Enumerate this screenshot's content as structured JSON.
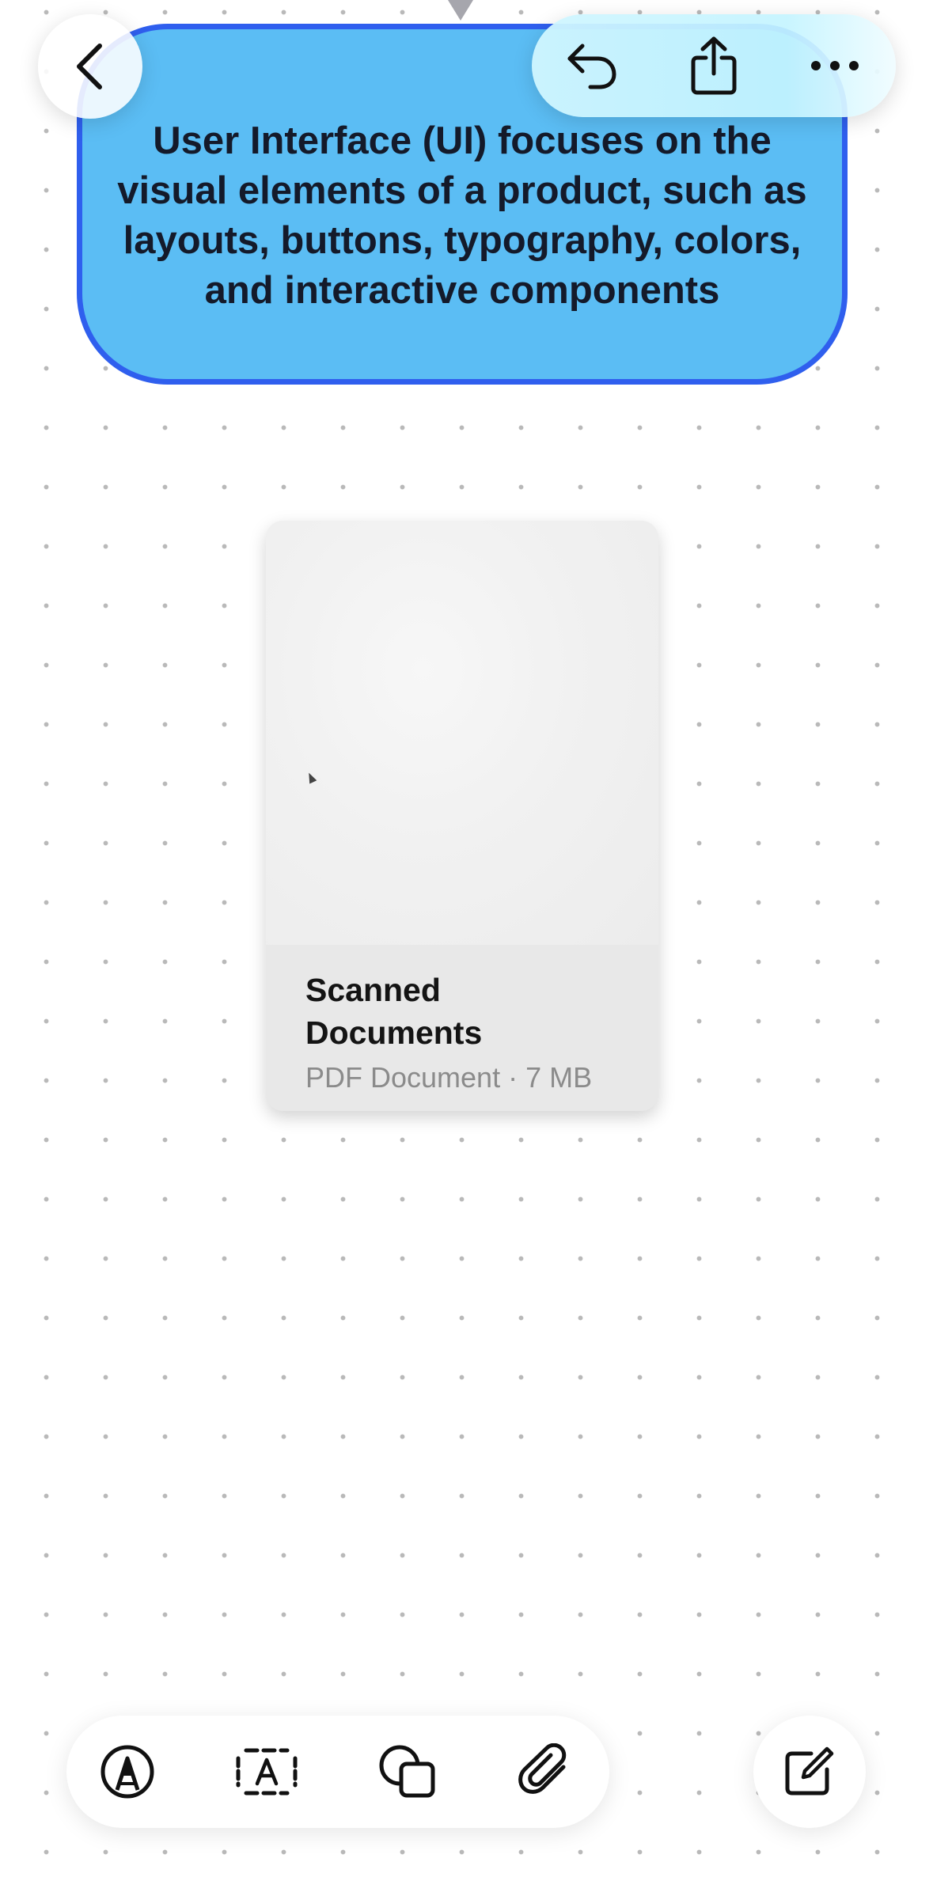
{
  "bubble": {
    "text": "User Interface (UI) focuses on the visual elements of a product, such as layouts, buttons, typography, colors, and interactive components"
  },
  "top_bar": {
    "back_icon": "chevron-left-icon",
    "undo_icon": "undo-icon",
    "share_icon": "share-icon",
    "more_icon": "ellipsis-icon"
  },
  "attachment": {
    "title": "Scanned Documents",
    "meta": "PDF Document · 7 MB"
  },
  "toolbar": {
    "pen_icon": "pen-icon",
    "text_icon": "text-box-icon",
    "shapes_icon": "shapes-icon",
    "attach_icon": "paperclip-icon",
    "compose_icon": "compose-icon"
  },
  "colors": {
    "bubble_fill": "#5bbdf4",
    "bubble_border": "#2f5fee"
  }
}
